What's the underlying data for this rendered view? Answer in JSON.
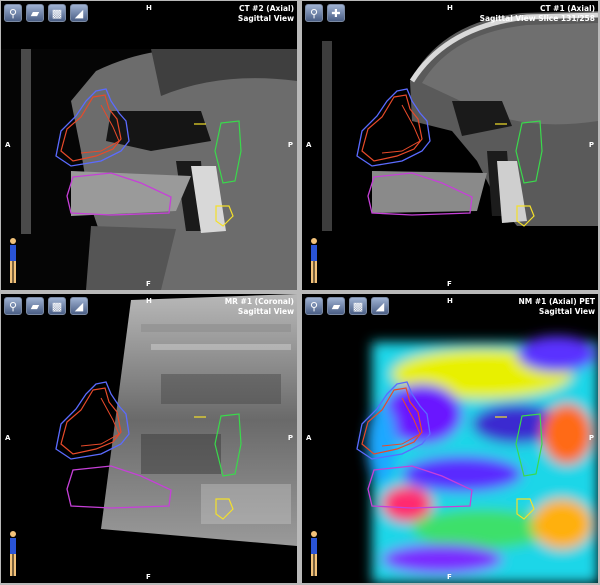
{
  "panels": [
    {
      "title": "CT #2 (Axial)",
      "subtitle": "Sagittal View"
    },
    {
      "title": "CT #1 (Axial)",
      "subtitle": "Sagittal View Slice 131/258"
    },
    {
      "title": "MR #1 (Coronal)",
      "subtitle": "Sagittal View"
    },
    {
      "title": "NM #1 (Axial) PET",
      "subtitle": "Sagittal View"
    }
  ],
  "orientation": {
    "top": "H",
    "bottom": "F",
    "left": "A",
    "right": "P"
  },
  "toolbar_icons": [
    "zoom-icon",
    "layers-icon",
    "histogram-icon",
    "window-level-icon",
    "pan-icon"
  ],
  "colors": {
    "contour_orange": "#e84a2a",
    "contour_blue": "#5b6bff",
    "contour_magenta": "#c640d8",
    "contour_green": "#3ad94c",
    "contour_yellow": "#f4e02a",
    "divider": "#b9b9b9"
  }
}
